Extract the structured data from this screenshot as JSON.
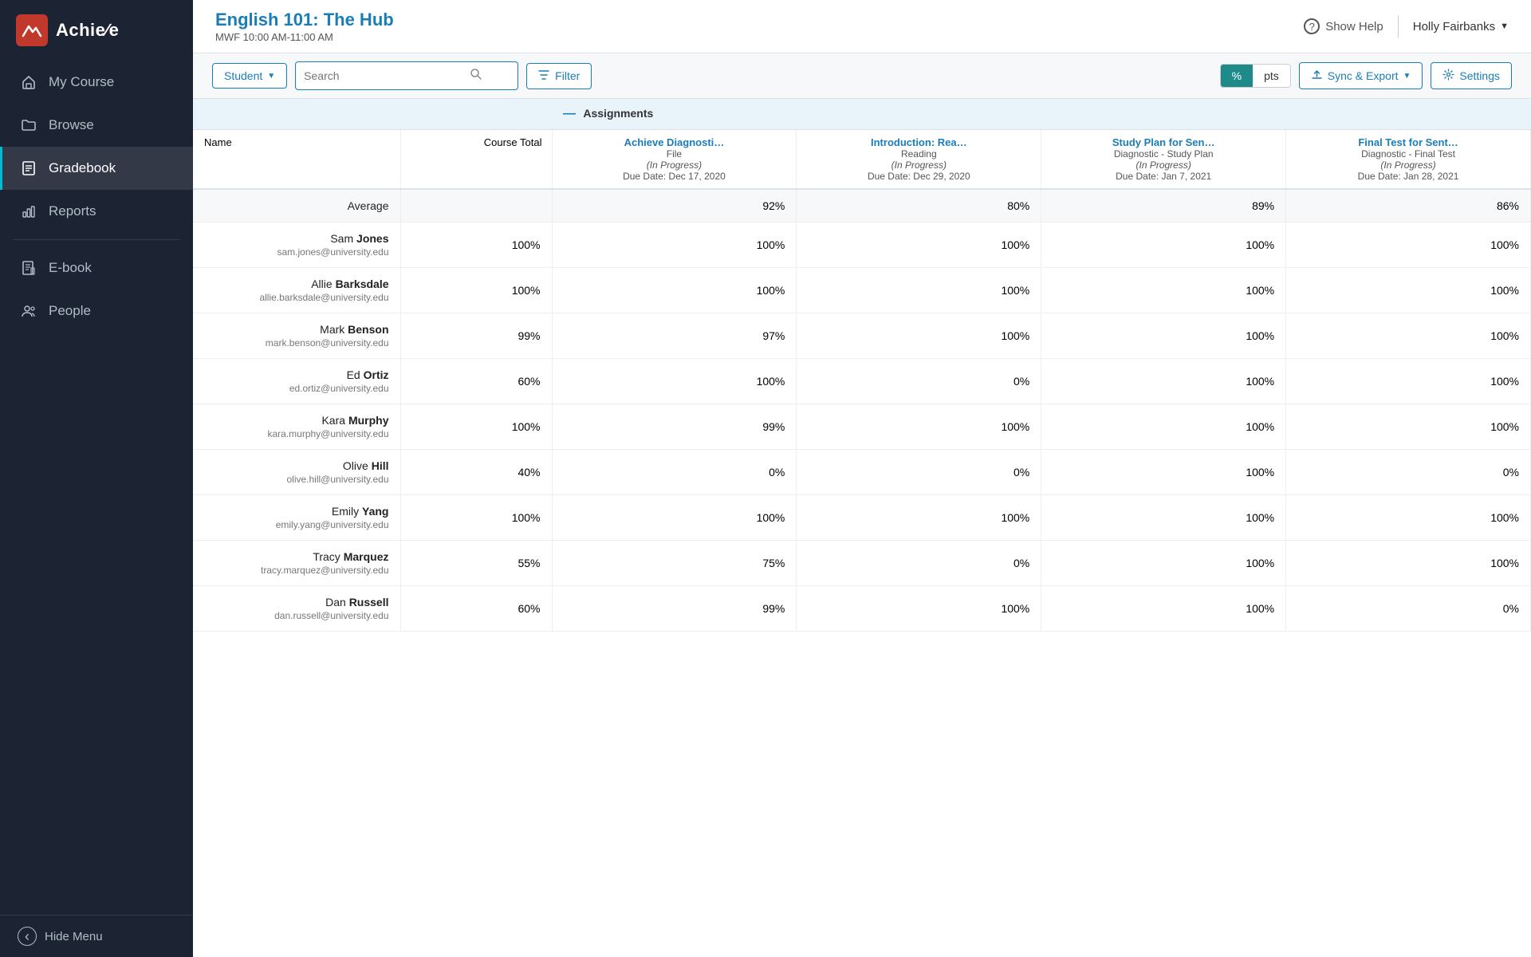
{
  "logo": {
    "text": "Achie∕e"
  },
  "sidebar": {
    "items": [
      {
        "id": "my-course",
        "label": "My Course",
        "icon": "home"
      },
      {
        "id": "browse",
        "label": "Browse",
        "icon": "folder"
      },
      {
        "id": "gradebook",
        "label": "Gradebook",
        "icon": "gradebook",
        "active": true
      },
      {
        "id": "reports",
        "label": "Reports",
        "icon": "bar-chart"
      },
      {
        "id": "ebook",
        "label": "E-book",
        "icon": "book"
      },
      {
        "id": "people",
        "label": "People",
        "icon": "people"
      }
    ],
    "hide_menu": "Hide Menu"
  },
  "header": {
    "course_title": "English 101: The Hub",
    "course_schedule": "MWF 10:00 AM-11:00 AM",
    "show_help": "Show Help",
    "user_name": "Holly Fairbanks"
  },
  "toolbar": {
    "student_dropdown": "Student",
    "search_placeholder": "Search",
    "filter": "Filter",
    "score_percent": "%",
    "score_pts": "pts",
    "sync_export": "Sync & Export",
    "settings": "Settings"
  },
  "gradebook": {
    "columns": {
      "name": "Name",
      "course_total": "Course Total",
      "assignments_group": "Assignments"
    },
    "assignments": [
      {
        "title": "Achieve Diagnosti…",
        "type": "File",
        "status": "(In Progress)",
        "due": "Due Date: Dec 17, 2020"
      },
      {
        "title": "Introduction: Rea…",
        "type": "Reading",
        "status": "(In Progress)",
        "due": "Due Date: Dec 29, 2020"
      },
      {
        "title": "Study Plan for Sen…",
        "type": "Diagnostic - Study Plan",
        "status": "(In Progress)",
        "due": "Due Date: Jan 7, 2021"
      },
      {
        "title": "Final Test for Sent…",
        "type": "Diagnostic - Final Test",
        "status": "(In Progress)",
        "due": "Due Date: Jan 28, 2021"
      }
    ],
    "average_row": {
      "label": "Average",
      "course_total": "",
      "scores": [
        "92%",
        "80%",
        "89%",
        "86%"
      ]
    },
    "students": [
      {
        "first": "Sam",
        "last": "Jones",
        "email": "sam.jones@university.edu",
        "course_total": "100%",
        "scores": [
          "100%",
          "100%",
          "100%",
          "100%"
        ]
      },
      {
        "first": "Allie",
        "last": "Barksdale",
        "email": "allie.barksdale@university.edu",
        "course_total": "100%",
        "scores": [
          "100%",
          "100%",
          "100%",
          "100%"
        ]
      },
      {
        "first": "Mark",
        "last": "Benson",
        "email": "mark.benson@university.edu",
        "course_total": "99%",
        "scores": [
          "97%",
          "100%",
          "100%",
          "100%"
        ]
      },
      {
        "first": "Ed",
        "last": "Ortiz",
        "email": "ed.ortiz@university.edu",
        "course_total": "60%",
        "scores": [
          "100%",
          "0%",
          "100%",
          "100%"
        ]
      },
      {
        "first": "Kara",
        "last": "Murphy",
        "email": "kara.murphy@university.edu",
        "course_total": "100%",
        "scores": [
          "99%",
          "100%",
          "100%",
          "100%"
        ]
      },
      {
        "first": "Olive",
        "last": "Hill",
        "email": "olive.hill@university.edu",
        "course_total": "40%",
        "scores": [
          "0%",
          "0%",
          "100%",
          "0%"
        ]
      },
      {
        "first": "Emily",
        "last": "Yang",
        "email": "emily.yang@university.edu",
        "course_total": "100%",
        "scores": [
          "100%",
          "100%",
          "100%",
          "100%"
        ]
      },
      {
        "first": "Tracy",
        "last": "Marquez",
        "email": "tracy.marquez@university.edu",
        "course_total": "55%",
        "scores": [
          "75%",
          "0%",
          "100%",
          "100%"
        ]
      },
      {
        "first": "Dan",
        "last": "Russell",
        "email": "dan.russell@university.edu",
        "course_total": "60%",
        "scores": [
          "99%",
          "100%",
          "100%",
          "0%"
        ]
      }
    ]
  }
}
